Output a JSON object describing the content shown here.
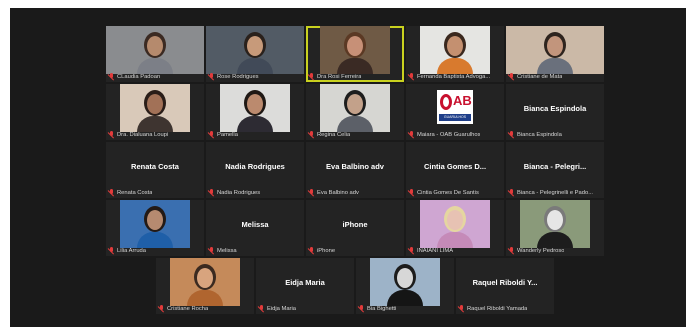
{
  "participants": [
    {
      "name": "CLaudia Padoan",
      "type": "video",
      "skin": "#b58a6d",
      "hair": "#3b2a22",
      "shirt": "#7c7f87",
      "bg": "#8a8c8f"
    },
    {
      "name": "Rose Rodrigues",
      "type": "video",
      "skin": "#c79a7a",
      "hair": "#2a211c",
      "shirt": "#414a58",
      "bg": "#525b65"
    },
    {
      "name": "Dra Rosi Ferreira",
      "type": "video",
      "skin": "#c79077",
      "hair": "#5b3924",
      "shirt": "#3a2a24",
      "bg": "#6f5a45",
      "active": true
    },
    {
      "name": "Fernanda Baptista Advoga...",
      "type": "video",
      "skin": "#c49070",
      "hair": "#3a281e",
      "shirt": "#d87a2e",
      "bg": "#e5e5e2"
    },
    {
      "name": "Cristiane de Mata",
      "type": "video",
      "skin": "#c2957c",
      "hair": "#2e241e",
      "shirt": "#6a707c",
      "bg": "#cbb9a7"
    },
    {
      "name": "Dra. Dialuana Loupi",
      "type": "video",
      "skin": "#a27157",
      "hair": "#2a1d18",
      "shirt": "#3e3430",
      "bg": "#d9c9b9"
    },
    {
      "name": "Pamella",
      "type": "video",
      "skin": "#bb8a6e",
      "hair": "#1f1814",
      "shirt": "#2d2b33",
      "bg": "#dcdcda"
    },
    {
      "name": "Regina Celia",
      "type": "video",
      "skin": "#c3a18a",
      "hair": "#1d1d1d",
      "shirt": "#5c6068",
      "bg": "#d6d6d2"
    },
    {
      "name": "Maiara - OAB Guarulhos",
      "type": "logo",
      "logo_text": "AB",
      "logo_city": "GUARULHOS"
    },
    {
      "name": "Bianca Espindola",
      "type": "name",
      "display": "Bianca Espindola"
    },
    {
      "name": "Renata Costa",
      "type": "name",
      "display": "Renata Costa"
    },
    {
      "name": "Nadia Rodrigues",
      "type": "name",
      "display": "Nadia Rodrigues"
    },
    {
      "name": "Eva Balbino adv",
      "type": "name",
      "display": "Eva Balbino adv"
    },
    {
      "name": "Cintia Gomes De Santis",
      "type": "name",
      "display": "Cintia Gomes D..."
    },
    {
      "name": "Bianca - Pelegrinelli e Pado...",
      "type": "name",
      "display": "Bianca - Pelegri..."
    },
    {
      "name": "Lilia Arruda",
      "type": "video",
      "skin": "#b68a70",
      "hair": "#231a16",
      "shirt": "#1f5fa8",
      "bg": "#3a6fb0"
    },
    {
      "name": "Melissa",
      "type": "name",
      "display": "Melissa"
    },
    {
      "name": "iPhone",
      "type": "name",
      "display": "iPhone"
    },
    {
      "name": "INAIANI LIMA",
      "type": "video",
      "skin": "#e7c2b3",
      "hair": "#e5d6a0",
      "shirt": "#c58ab8",
      "bg": "#cfa6d2"
    },
    {
      "name": "Wanderly Pedroso",
      "type": "video",
      "skin": "#e6e6e6",
      "hair": "#7a7a7a",
      "shirt": "#1d1d1d",
      "bg": "#8a9a7a"
    },
    {
      "name": "Cristiane Rocha",
      "type": "video",
      "skin": "#d8a47e",
      "hair": "#3b2a20",
      "shirt": "#b0652f",
      "bg": "#c58a5a"
    },
    {
      "name": "Eidja Maria",
      "type": "name",
      "display": "Eidja Maria"
    },
    {
      "name": "Bia Bighetti",
      "type": "video",
      "skin": "#d7d7d7",
      "hair": "#1c1c1c",
      "shirt": "#151515",
      "bg": "#9db3c8"
    },
    {
      "name": "Raquel Riboldi Yamada",
      "type": "name",
      "display": "Raquel Riboldi Y..."
    }
  ],
  "colors": {
    "background": "#1a1a1a",
    "tile": "#232323",
    "active_border": "#c9d21f",
    "muted_mic": "#e23b3b"
  }
}
